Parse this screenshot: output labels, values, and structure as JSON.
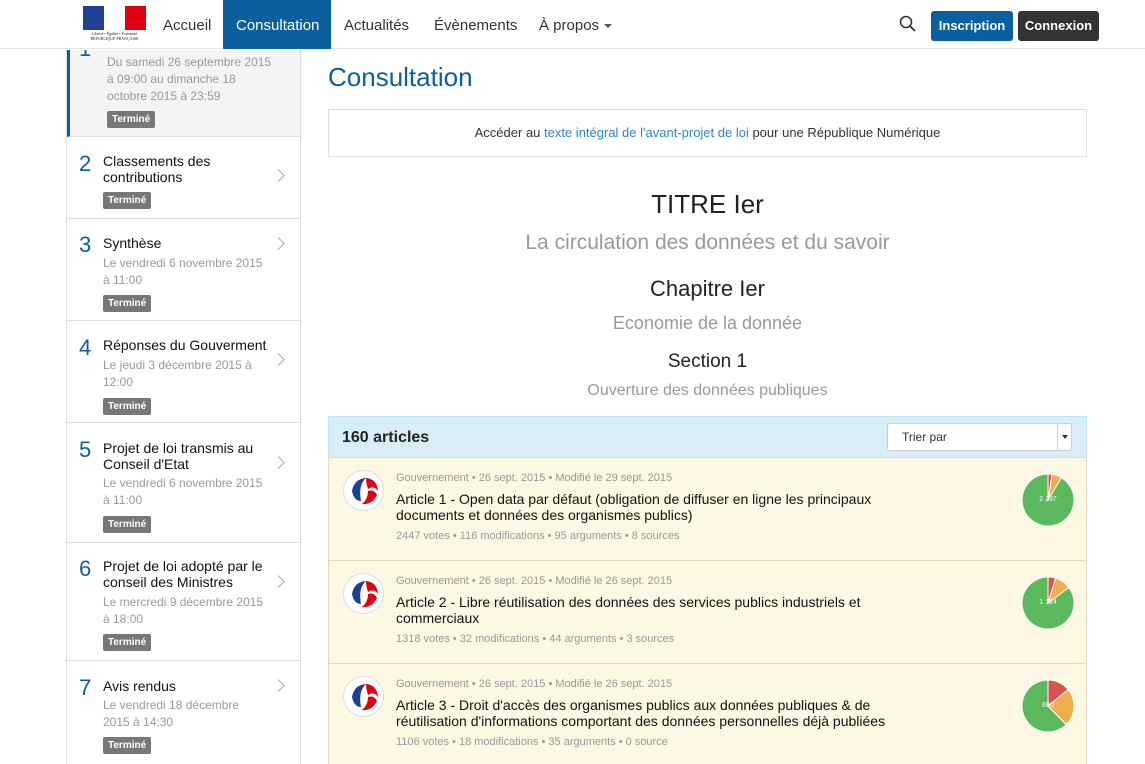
{
  "logo": {
    "text": "Liberté • Égalité • Fraternité RÉPUBLIQUE FRANÇAISE",
    "colors": [
      "#1f3f95",
      "#ffffff",
      "#e1000f"
    ]
  },
  "nav": {
    "items": [
      "Accueil",
      "Consultation",
      "Actualités",
      "Évènements",
      "À propos"
    ],
    "active": "Consultation",
    "inscription": "Inscription",
    "connexion": "Connexion"
  },
  "sidebar": {
    "steps": [
      {
        "num": "1",
        "title": "",
        "date": "Du samedi 26 septembre 2015 à 09:00 au dimanche 18 octobre 2015 à 23:59",
        "badge": "Terminé"
      },
      {
        "num": "2",
        "title": "Classements des contributions",
        "date": "",
        "badge": "Terminé"
      },
      {
        "num": "3",
        "title": "Synthèse",
        "date": "Le vendredi 6 novembre 2015 à 11:00",
        "badge": "Terminé"
      },
      {
        "num": "4",
        "title": "Réponses du Gouverment",
        "date": "Le jeudi 3 décembre 2015 à 12:00",
        "badge": "Terminé"
      },
      {
        "num": "5",
        "title": "Projet de loi transmis au Conseil d'Etat",
        "date": "Le vendredi 6 novembre 2015 à 11:00",
        "badge": "Terminé"
      },
      {
        "num": "6",
        "title": "Projet de loi adopté par le conseil des Ministres",
        "date": "Le mercredi 9 décembre 2015 à 18:00",
        "badge": "Terminé"
      },
      {
        "num": "7",
        "title": "Avis rendus",
        "date": "Le vendredi 18 décembre 2015 à 14:30",
        "badge": "Terminé"
      }
    ]
  },
  "main": {
    "title": "Consultation",
    "intro_before": "Accéder au ",
    "intro_link": "texte intégral de l'avant-projet de loi",
    "intro_after": " pour une République Numérique",
    "titre": "TITRE Ier",
    "titre_sub": "La circulation des données et du savoir",
    "chapitre": "Chapitre Ier",
    "chapitre_sub": "Economie de la donnée",
    "section": "Section 1",
    "section_sub": "Ouverture des données publiques",
    "count": "160 articles",
    "sort_label": "Trier par"
  },
  "articles": [
    {
      "meta": "Gouvernement • 26 sept. 2015 • Modifié le 29 sept. 2015",
      "title": "Article 1 - Open data par défaut (obligation de diffuser en ligne les principaux documents et données des organismes publics)",
      "stats": "2447 votes • 116 modifications • 95 arguments • 8 sources",
      "pie_label": "2 237",
      "pie": [
        {
          "value": 2237,
          "color": "#5cb85c"
        },
        {
          "value": 150,
          "color": "#f0ad4e"
        },
        {
          "value": 60,
          "color": "#d9534f"
        }
      ]
    },
    {
      "meta": "Gouvernement • 26 sept. 2015 • Modifié le 26 sept. 2015",
      "title": "Article 2 - Libre réutilisation des données des services publics industriels et commerciaux",
      "stats": "1318 votes • 32 modifications • 44 arguments • 3 sources",
      "pie_label": "1 124",
      "pie": [
        {
          "value": 1124,
          "color": "#5cb85c"
        },
        {
          "value": 132,
          "color": "#f0ad4e"
        },
        {
          "value": 62,
          "color": "#d9534f"
        }
      ]
    },
    {
      "meta": "Gouvernement • 26 sept. 2015 • Modifié le 26 sept. 2015",
      "title": "Article 3 - Droit d'accès des organismes publics aux données publiques & de réutilisation d'informations comportant des données personnelles déjà publiées",
      "stats": "1106 votes • 18 modifications • 35 arguments • 0 source",
      "pie_label": "690",
      "pie": [
        {
          "value": 690,
          "color": "#5cb85c"
        },
        {
          "value": 260,
          "color": "#f0ad4e"
        },
        {
          "value": 156,
          "color": "#d9534f"
        }
      ]
    }
  ]
}
